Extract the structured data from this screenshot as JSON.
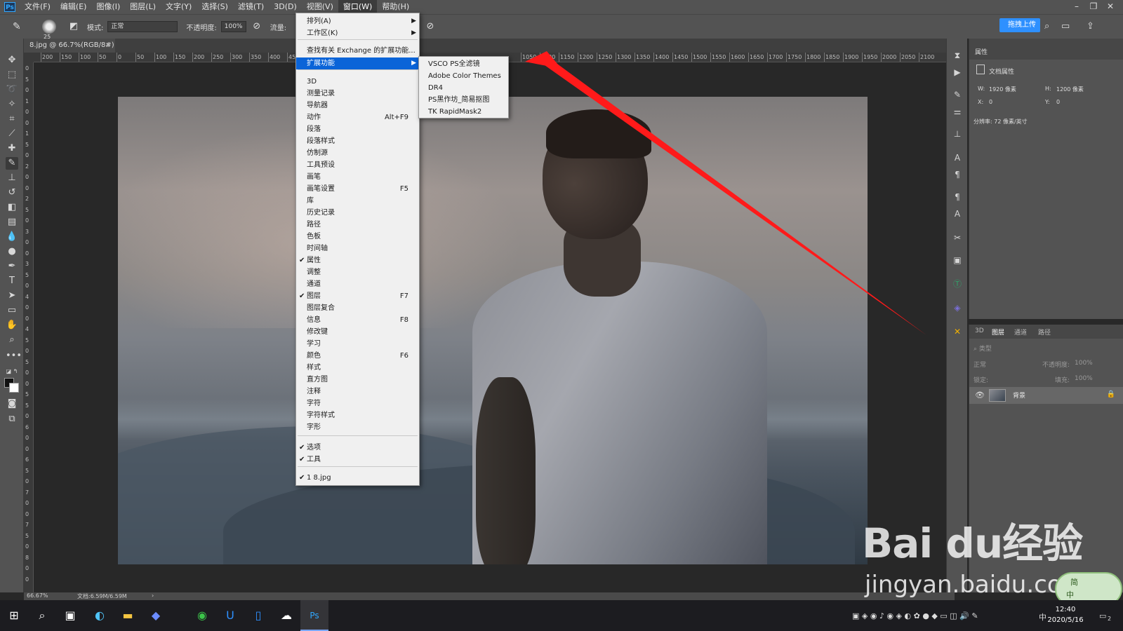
{
  "menubar": {
    "logo": "Ps",
    "items": [
      "文件(F)",
      "编辑(E)",
      "图像(I)",
      "图层(L)",
      "文字(Y)",
      "选择(S)",
      "滤镜(T)",
      "3D(D)",
      "视图(V)",
      "窗口(W)",
      "帮助(H)"
    ],
    "active_item": "窗口(W)"
  },
  "window_controls": [
    "–",
    "❐",
    "✕"
  ],
  "options_bar": {
    "brush_size": "25",
    "mode_label": "模式:",
    "mode_value": "正常",
    "opacity_label": "不透明度:",
    "opacity_value": "100%",
    "flow_label": "流量:",
    "cloud_button": "拖拽上传"
  },
  "document_tab": {
    "title": "8.jpg @ 66.7%(RGB/8#)",
    "close": "×"
  },
  "ruler": {
    "top_ticks": [
      "200",
      "150",
      "100",
      "50",
      "0",
      "50",
      "100",
      "150",
      "200",
      "250",
      "300",
      "350",
      "400",
      "450",
      "1050",
      "1100",
      "1150",
      "1200",
      "1250",
      "1300",
      "1350",
      "1400",
      "1450",
      "1500",
      "1550",
      "1600",
      "1650",
      "1700",
      "1750",
      "1800",
      "1850",
      "1900",
      "1950",
      "2000",
      "2050",
      "2100"
    ],
    "left_ticks": [
      "0",
      "5",
      "0",
      "1",
      "0",
      "0",
      "1",
      "5",
      "0",
      "2",
      "0",
      "0",
      "2",
      "5",
      "0",
      "3",
      "0",
      "0",
      "3",
      "5",
      "0",
      "4",
      "0",
      "0",
      "4",
      "5",
      "0",
      "5",
      "0",
      "0",
      "5",
      "5",
      "0",
      "6",
      "0",
      "0",
      "6",
      "5",
      "0",
      "7",
      "0",
      "0",
      "7",
      "5",
      "0",
      "8",
      "0",
      "0"
    ]
  },
  "window_menu": {
    "items": [
      {
        "label": "排列(A)",
        "submenu": true
      },
      {
        "label": "工作区(K)",
        "submenu": true
      },
      {
        "label": "查找有关 Exchange 的扩展功能..."
      },
      {
        "label": "扩展功能",
        "submenu": true,
        "highlighted": true
      },
      {
        "label": "3D"
      },
      {
        "label": "测量记录"
      },
      {
        "label": "导航器"
      },
      {
        "label": "动作",
        "shortcut": "Alt+F9"
      },
      {
        "label": "段落"
      },
      {
        "label": "段落样式"
      },
      {
        "label": "仿制源"
      },
      {
        "label": "工具预设"
      },
      {
        "label": "画笔"
      },
      {
        "label": "画笔设置",
        "shortcut": "F5"
      },
      {
        "label": "库"
      },
      {
        "label": "历史记录"
      },
      {
        "label": "路径"
      },
      {
        "label": "色板"
      },
      {
        "label": "时间轴"
      },
      {
        "label": "属性",
        "checked": true
      },
      {
        "label": "调整"
      },
      {
        "label": "通道"
      },
      {
        "label": "图层",
        "checked": true,
        "shortcut": "F7"
      },
      {
        "label": "图层复合"
      },
      {
        "label": "信息",
        "shortcut": "F8"
      },
      {
        "label": "修改键"
      },
      {
        "label": "学习"
      },
      {
        "label": "颜色",
        "shortcut": "F6"
      },
      {
        "label": "样式"
      },
      {
        "label": "直方图"
      },
      {
        "label": "注释"
      },
      {
        "label": "字符"
      },
      {
        "label": "字符样式"
      },
      {
        "label": "字形"
      },
      {
        "label": "选项",
        "checked": true
      },
      {
        "label": "工具",
        "checked": true
      },
      {
        "label": "1 8.jpg",
        "checked": true
      }
    ]
  },
  "extensions_submenu": {
    "items": [
      "VSCO PS全滤镜",
      "Adobe Color Themes",
      "DR4",
      "PS黑作坊_简易抠图",
      "TK RapidMask2"
    ]
  },
  "properties_panel": {
    "title": "属性",
    "doc_label": "文档属性",
    "w_label": "W:",
    "w_value": "1920 像素",
    "h_label": "H:",
    "h_value": "1200 像素",
    "x_label": "X:",
    "x_value": "0",
    "y_label": "Y:",
    "y_value": "0",
    "resolution": "分辨率: 72 像素/英寸"
  },
  "layers_panel": {
    "tabs": [
      "3D",
      "图层",
      "通道",
      "路径"
    ],
    "active_tab": "图层",
    "filter_placeholder": "类型",
    "blend_mode": "正常",
    "opacity_label": "不透明度:",
    "opacity_value": "100%",
    "lock_label": "锁定:",
    "fill_label": "填充:",
    "fill_value": "100%",
    "layer_name": "背景"
  },
  "statusbar": {
    "zoom": "66.67%",
    "doc_info": "文档:6.59M/6.59M",
    "arrow": "›"
  },
  "taskbar": {
    "time": "12:40",
    "date": "2020/5/16",
    "ime_mode": "中",
    "ime_simplified": "简",
    "notification_count": "2"
  },
  "watermark": {
    "brand": "Bai du经验",
    "url": "jingyan.baidu.com"
  },
  "colors": {
    "accent": "#0a64d8",
    "arrow": "#ff1a1a",
    "ui_bg": "#535353",
    "canvas_bg": "#282828"
  }
}
